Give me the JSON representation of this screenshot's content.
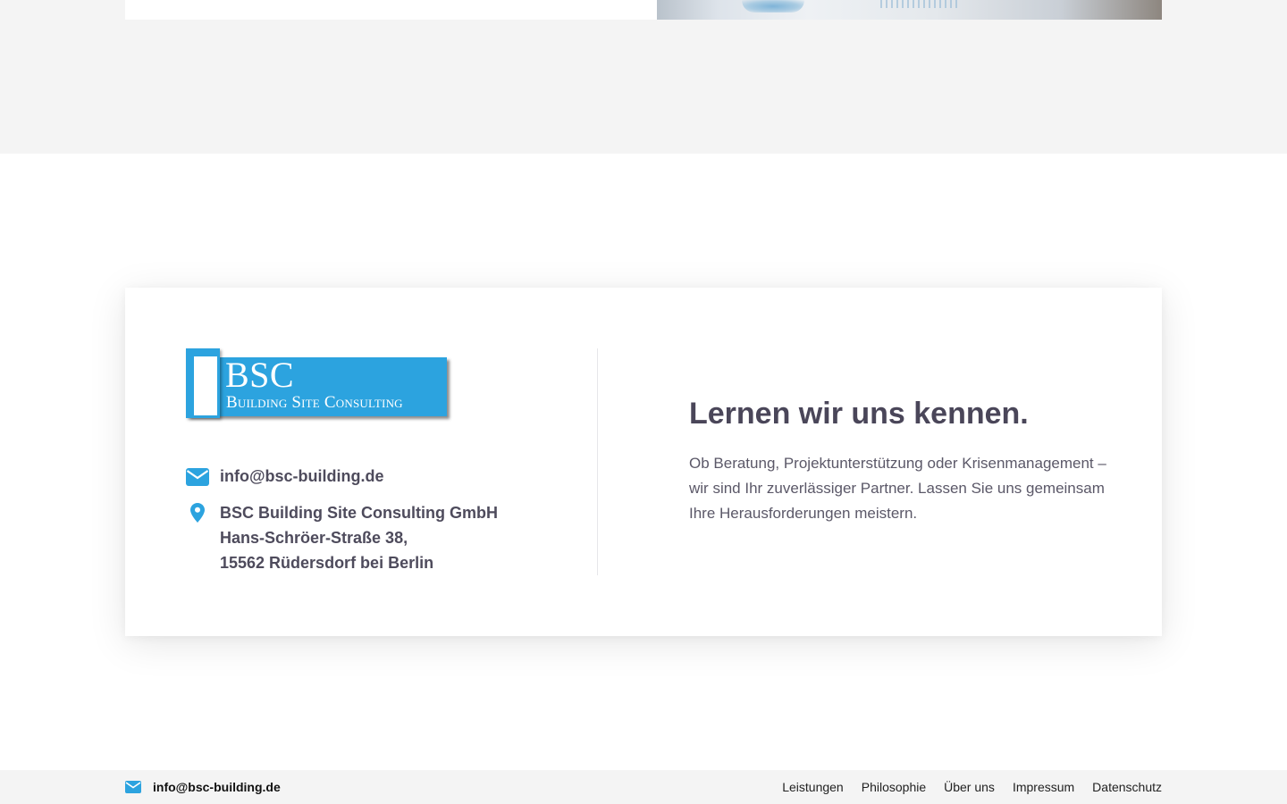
{
  "colors": {
    "accent": "#2ca3df",
    "text": "#4e4b5c",
    "band": "#f4f4f4"
  },
  "logo": {
    "short": "BSC",
    "full": "Building Site Consulting"
  },
  "contact": {
    "email_icon": "envelope-icon",
    "email": "info@bsc-building.de",
    "address_icon": "map-pin-icon",
    "address_line1": "BSC Building Site Consulting GmbH",
    "address_line2": "Hans-Schröer-Straße 38,",
    "address_line3": "15562 Rüdersdorf bei Berlin"
  },
  "cta": {
    "headline": "Lernen wir uns kennen.",
    "text": "Ob Beratung, Projektunterstützung oder Krisenmanagement – wir sind Ihr zuverlässiger Partner. Lassen Sie uns gemeinsam Ihre Herausforderungen meistern."
  },
  "footer": {
    "email_icon": "envelope-icon",
    "email": "info@bsc-building.de",
    "nav": [
      "Leistungen",
      "Philosophie",
      "Über uns",
      "Impressum",
      "Datenschutz"
    ]
  }
}
